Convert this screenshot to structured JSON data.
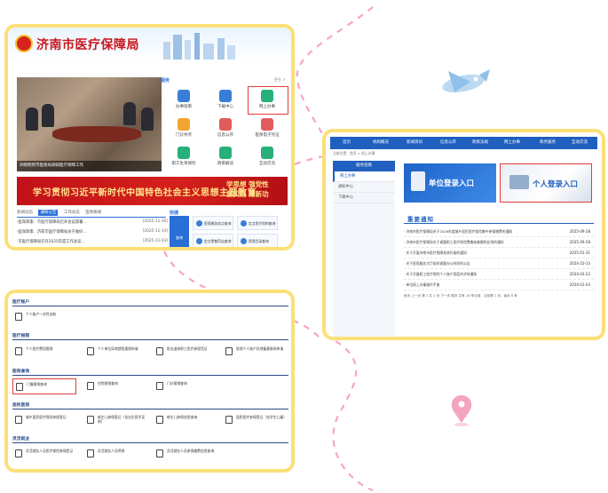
{
  "homepage": {
    "site_title": "济南市医疗保障局",
    "photo_caption": "孙晓明到市医保局调研医疗保障工作",
    "services_tab": "服务",
    "more": "更多 >",
    "services": [
      {
        "label": "办事指南"
      },
      {
        "label": "下载中心"
      },
      {
        "label": "网上办事"
      },
      {
        "label": "门诊共济"
      },
      {
        "label": "信息公开"
      },
      {
        "label": "医保电子凭证"
      },
      {
        "label": "职工生育保险"
      },
      {
        "label": "政策解读"
      },
      {
        "label": "互动交流"
      }
    ],
    "banner_left": "学习贯彻习近平新时代中国特色社会主义思想主题教育",
    "banner_right_1": "学思想  强党性",
    "banner_right_2": "重实践  建新功",
    "news_tabs": [
      "新闻动态",
      "通知公告",
      "工作动态",
      "医保要闻"
    ],
    "news": [
      {
        "title": "·医保政策：市医疗保障局召开会议部署…",
        "date": "[2025-11-26]"
      },
      {
        "title": "·医保政策：济南市医疗保障局关于做好…",
        "date": "[2025-11-14]"
      },
      {
        "title": "·市医疗保障局召开2025年度工作会议…",
        "date": "[2025-11-03]"
      }
    ],
    "quick_tab": "快捷",
    "quick_big": "查询",
    "quick": [
      {
        "label": "医保服务站点查询"
      },
      {
        "label": "定点医疗机构查询"
      },
      {
        "label": "定点零售药店查询"
      },
      {
        "label": "医保目录查询"
      }
    ]
  },
  "portal": {
    "nav": [
      "首页",
      "机构概况",
      "新闻资讯",
      "信息公开",
      "政策法规",
      "网上办事",
      "政务服务",
      "互动交流"
    ],
    "breadcrumb": "当前位置：首页 > 网上办事",
    "side_title": "服务指南",
    "side_items": [
      {
        "label": "网上办事"
      },
      {
        "label": "通知中心"
      },
      {
        "label": "下载中心"
      }
    ],
    "login_unit": "单位登录入口",
    "login_person": "个人登录入口",
    "notice_title": "重要通知",
    "notices": [
      {
        "title": "· 济南市医疗保障局关于2026年度城乡居民医疗保险集中参保缴费的通知",
        "date": "2025-09-28"
      },
      {
        "title": "· 济南市医疗保障局关于调整职工医疗保险费缴纳基数和比例的通知",
        "date": "2025-09-28"
      },
      {
        "title": "· 关于开展济南市医疗保障系统升级的通知",
        "date": "2025-01-31"
      },
      {
        "title": "· 关于医保服务大厅临时调整办公时间的公告",
        "date": "2024-10-13"
      },
      {
        "title": "· 关于开展职工医疗保险个人账户家庭共济的通知",
        "date": "2024-03-22"
      },
      {
        "title": "· 单位网上办事操作手册",
        "date": "2024-01-03"
      }
    ],
    "pager": "首页  上一页  第 1 共 1 页  下一页  尾页     共有 16 条记录，当前第 1 页，每页 6 条"
  },
  "services_page": {
    "sections": [
      {
        "title": "医疗账户",
        "items": [
          {
            "label": "个人账户一次性支取"
          }
        ]
      },
      {
        "title": "医疗报销",
        "items": [
          {
            "label": "个人医疗费用报销"
          },
          {
            "label": "个人单位异地就医报销申请"
          },
          {
            "label": "职业退休职工医疗参保凭证"
          },
          {
            "label": "医保个人账户异地备案联网申请"
          }
        ]
      },
      {
        "title": "医保查询",
        "items": [
          {
            "label": "门慢报销查询"
          },
          {
            "label": "住院报销查询"
          },
          {
            "label": "门诊报销查询"
          }
        ]
      },
      {
        "title": "居民医保",
        "items": [
          {
            "label": "城乡居民医疗保险参保登记"
          },
          {
            "label": "新生儿参保登记（含出生医学证明）"
          },
          {
            "label": "新生儿参保信息查询"
          },
          {
            "label": "居民医疗参保登记（含学生儿童）"
          }
        ]
      },
      {
        "title": "灵活就业",
        "items": [
          {
            "label": "灵活就业人员医疗保险参保登记"
          },
          {
            "label": "灵活就业人员停保"
          },
          {
            "label": "灵活就业人员参保缴费信息查询"
          }
        ]
      }
    ]
  }
}
